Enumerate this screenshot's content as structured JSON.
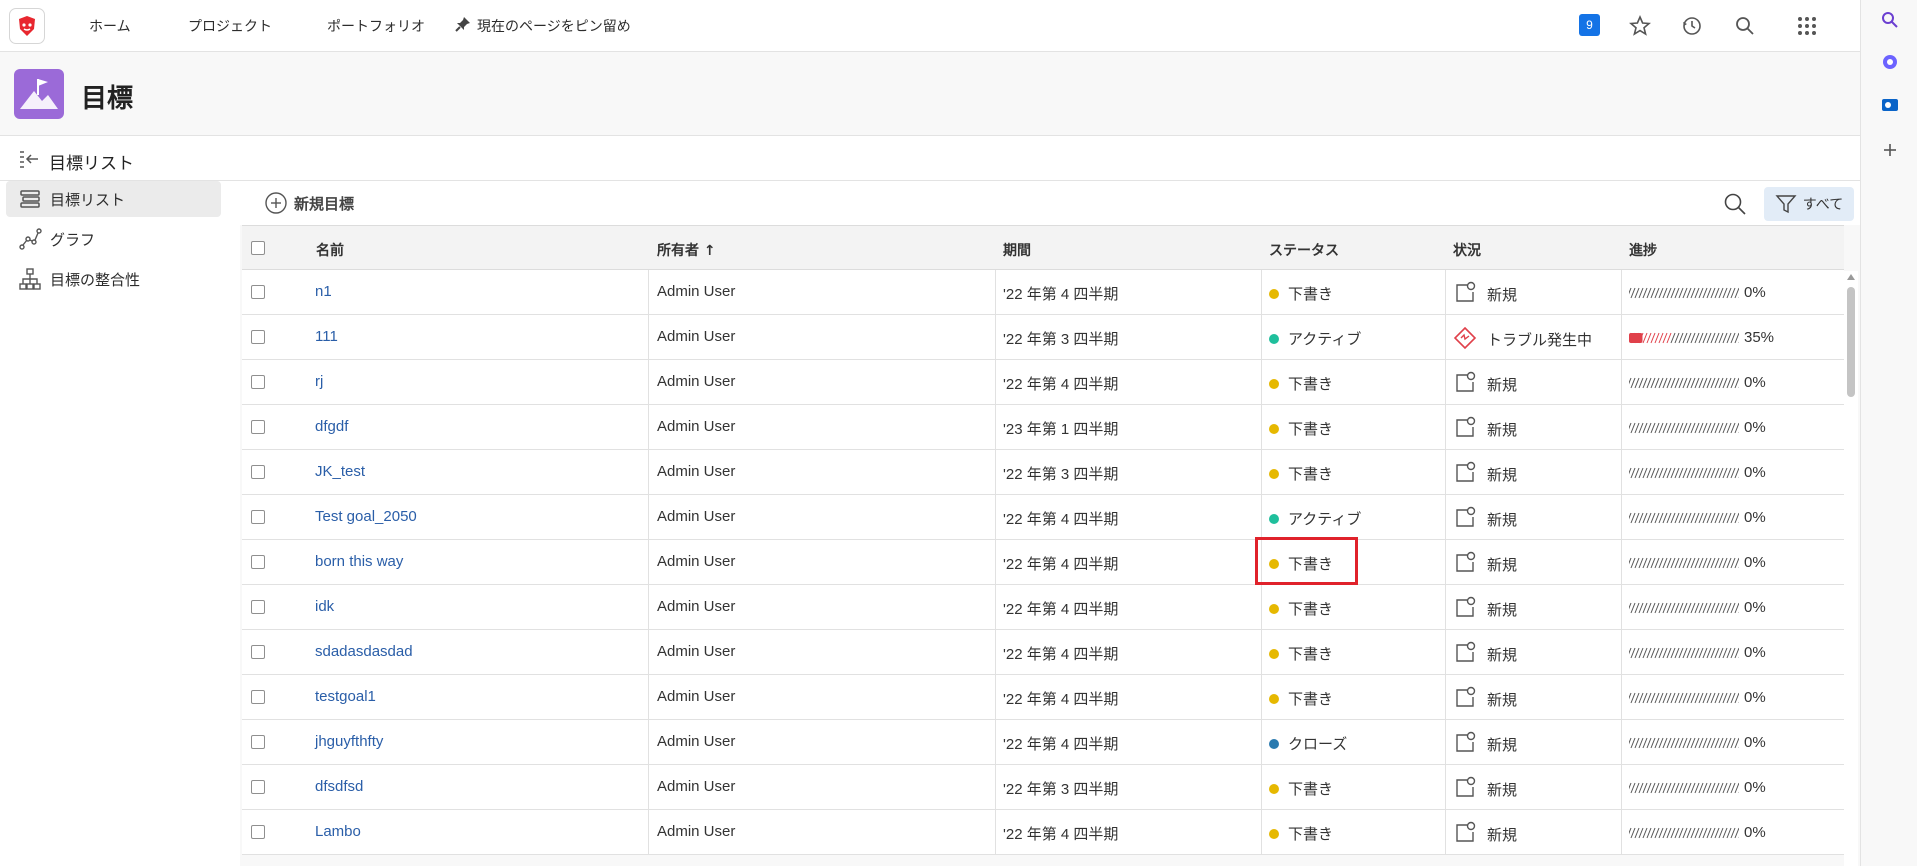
{
  "nav": {
    "items": [
      "ホーム",
      "プロジェクト",
      "ポートフォリオ"
    ],
    "pin_label": "現在のページをピン留め",
    "notification_count": "9",
    "accent": "#1473e6"
  },
  "header": {
    "title": "目標",
    "icon_color": "#9b6ad8"
  },
  "subheader": {
    "title": "目標リスト"
  },
  "sidebar": {
    "items": [
      {
        "label": "目標リスト",
        "active": true
      },
      {
        "label": "グラフ",
        "active": false
      },
      {
        "label": "目標の整合性",
        "active": false
      }
    ]
  },
  "toolbar": {
    "new_goal_label": "新規目標",
    "filter_label": "すべて"
  },
  "table": {
    "columns": {
      "name": "名前",
      "owner": "所有者 ↑",
      "period": "期間",
      "status": "ステータス",
      "condition": "状況",
      "progress": "進捗"
    },
    "rows": [
      {
        "name": "n1",
        "owner": "Admin User",
        "period": "'22 年第 4 四半期",
        "status": "下書き",
        "condition": "新規",
        "progress": "0%"
      },
      {
        "name": "111",
        "owner": "Admin User",
        "period": "'22 年第 3 四半期",
        "status": "アクティブ",
        "condition": "トラブル発生中",
        "progress": "35%"
      },
      {
        "name": "rj",
        "owner": "Admin User",
        "period": "'22 年第 4 四半期",
        "status": "下書き",
        "condition": "新規",
        "progress": "0%"
      },
      {
        "name": "dfgdf",
        "owner": "Admin User",
        "period": "'23 年第 1 四半期",
        "status": "下書き",
        "condition": "新規",
        "progress": "0%"
      },
      {
        "name": "JK_test",
        "owner": "Admin User",
        "period": "'22 年第 3 四半期",
        "status": "下書き",
        "condition": "新規",
        "progress": "0%"
      },
      {
        "name": "Test goal_2050",
        "owner": "Admin User",
        "period": "'22 年第 4 四半期",
        "status": "アクティブ",
        "condition": "新規",
        "progress": "0%"
      },
      {
        "name": "born this way",
        "owner": "Admin User",
        "period": "'22 年第 4 四半期",
        "status": "下書き",
        "condition": "新規",
        "progress": "0%"
      },
      {
        "name": "idk",
        "owner": "Admin User",
        "period": "'22 年第 4 四半期",
        "status": "下書き",
        "condition": "新規",
        "progress": "0%"
      },
      {
        "name": "sdadasdasdad",
        "owner": "Admin User",
        "period": "'22 年第 4 四半期",
        "status": "下書き",
        "condition": "新規",
        "progress": "0%"
      },
      {
        "name": "testgoal1",
        "owner": "Admin User",
        "period": "'22 年第 4 四半期",
        "status": "下書き",
        "condition": "新規",
        "progress": "0%"
      },
      {
        "name": "jhguyfthfty",
        "owner": "Admin User",
        "period": "'22 年第 4 四半期",
        "status": "クローズ",
        "condition": "新規",
        "progress": "0%"
      },
      {
        "name": "dfsdfsd",
        "owner": "Admin User",
        "period": "'22 年第 3 四半期",
        "status": "下書き",
        "condition": "新規",
        "progress": "0%"
      },
      {
        "name": "Lambo",
        "owner": "Admin User",
        "period": "'22 年第 4 四半期",
        "status": "下書き",
        "condition": "新規",
        "progress": "0%"
      }
    ],
    "status_colors": {
      "下書き": "#e6b800",
      "アクティブ": "#1fbf9c",
      "クローズ": "#2a7aaf"
    },
    "trouble_color": "#e0404a"
  }
}
